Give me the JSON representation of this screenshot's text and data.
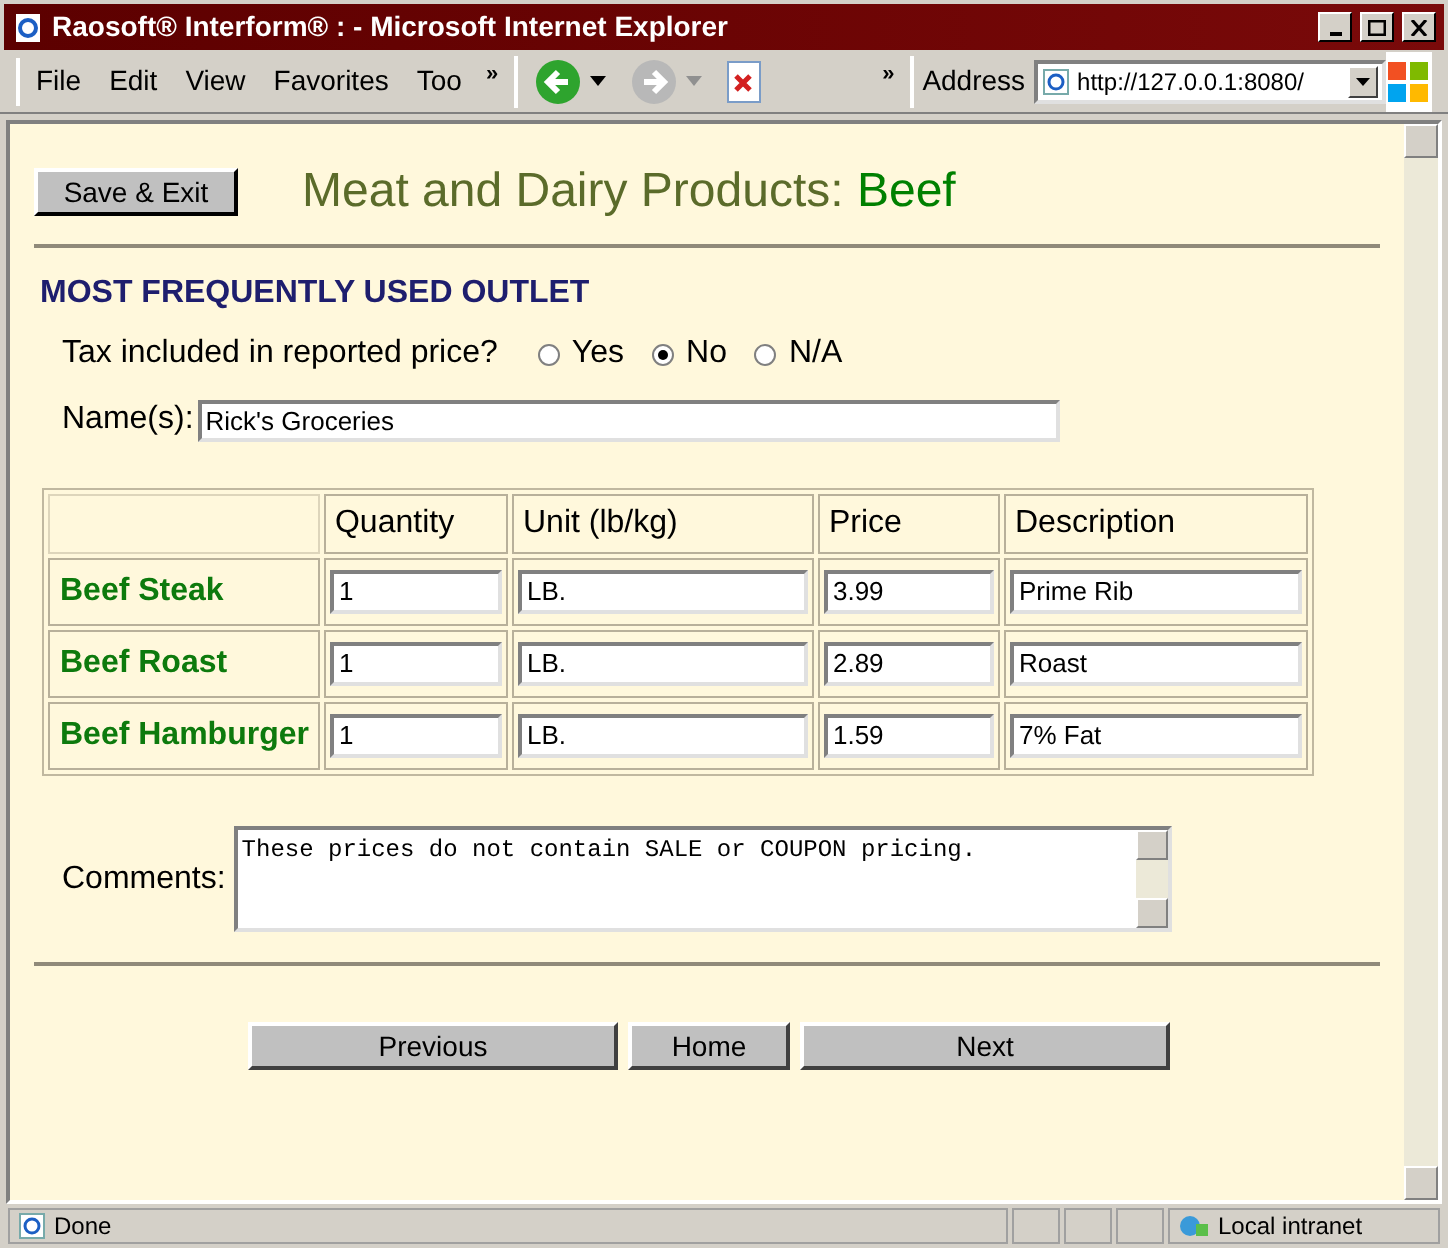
{
  "window": {
    "title": "Raosoft® Interform® : - Microsoft Internet Explorer"
  },
  "menu": [
    "File",
    "Edit",
    "View",
    "Favorites",
    "Too"
  ],
  "overflow": [
    "»",
    "»"
  ],
  "address": {
    "label": "Address",
    "value": "http://127.0.0.1:8080/"
  },
  "page": {
    "save_button": "Save & Exit",
    "title": "Meat and Dairy Products:",
    "category": "Beef",
    "section_heading": "MOST FREQUENTLY USED OUTLET",
    "tax": {
      "label": "Tax included in reported price?",
      "options": [
        {
          "label": "Yes",
          "selected": false
        },
        {
          "label": "No",
          "selected": true
        },
        {
          "label": "N/A",
          "selected": false
        }
      ]
    },
    "names": {
      "label": "Name(s):",
      "value": "Rick's Groceries"
    },
    "table": {
      "columns": [
        "Quantity",
        "Unit (lb/kg)",
        "Price",
        "Description"
      ],
      "rows": [
        {
          "label": "Beef Steak",
          "cells": [
            "1",
            "LB.",
            "3.99",
            "Prime Rib"
          ]
        },
        {
          "label": "Beef Roast",
          "cells": [
            "1",
            "LB.",
            "2.89",
            "Roast"
          ]
        },
        {
          "label": "Beef Hamburger",
          "cells": [
            "1",
            "LB.",
            "1.59",
            "7% Fat"
          ]
        }
      ]
    },
    "comments": {
      "label": "Comments:",
      "value": "These prices do not contain SALE or COUPON pricing."
    },
    "nav_buttons": [
      "Previous",
      "Home",
      "Next"
    ]
  },
  "status_bar": {
    "text": "Done",
    "zone": "Local intranet"
  }
}
